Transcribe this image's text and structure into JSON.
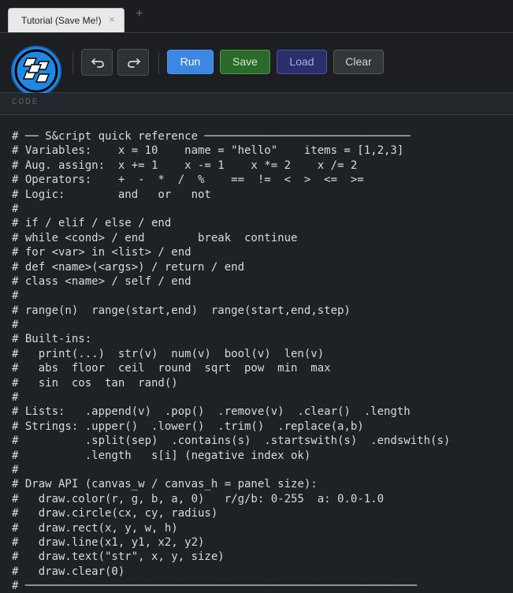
{
  "tabs": [
    {
      "label": "Tutorial (Save Me!)",
      "close": "×"
    }
  ],
  "tab_add": "+",
  "toolbar": {
    "undo_icon": "undo-arrow-icon",
    "redo_icon": "redo-arrow-icon",
    "run_label": "Run",
    "save_label": "Save",
    "load_label": "Load",
    "clear_label": "Clear"
  },
  "section": {
    "label": "CODE"
  },
  "colors": {
    "run": "#3b87e3",
    "save": "#2c6a2b",
    "load": "#2a2f6a",
    "clear": "#33363b",
    "logo": "#1e88e5"
  },
  "code_lines": [
    "# ── S&cript quick reference ───────────────────────────────",
    "# Variables:    x = 10    name = \"hello\"    items = [1,2,3]",
    "# Aug. assign:  x += 1    x -= 1    x *= 2    x /= 2",
    "# Operators:    +  -  *  /  %    ==  !=  <  >  <=  >=",
    "# Logic:        and   or   not",
    "#",
    "# if / elif / else / end",
    "# while <cond> / end        break  continue",
    "# for <var> in <list> / end",
    "# def <name>(<args>) / return / end",
    "# class <name> / self / end",
    "#",
    "# range(n)  range(start,end)  range(start,end,step)",
    "#",
    "# Built-ins:",
    "#   print(...)  str(v)  num(v)  bool(v)  len(v)",
    "#   abs  floor  ceil  round  sqrt  pow  min  max",
    "#   sin  cos  tan  rand()",
    "#",
    "# Lists:   .append(v)  .pop()  .remove(v)  .clear()  .length",
    "# Strings: .upper()  .lower()  .trim()  .replace(a,b)",
    "#          .split(sep)  .contains(s)  .startswith(s)  .endswith(s)",
    "#          .length   s[i] (negative index ok)",
    "#",
    "# Draw API (canvas_w / canvas_h = panel size):",
    "#   draw.color(r, g, b, a, 0)   r/g/b: 0-255  a: 0.0-1.0",
    "#   draw.circle(cx, cy, radius)",
    "#   draw.rect(x, y, w, h)",
    "#   draw.line(x1, y1, x2, y2)",
    "#   draw.text(\"str\", x, y, size)",
    "#   draw.clear(0)",
    "# ───────────────────────────────────────────────────────────"
  ]
}
